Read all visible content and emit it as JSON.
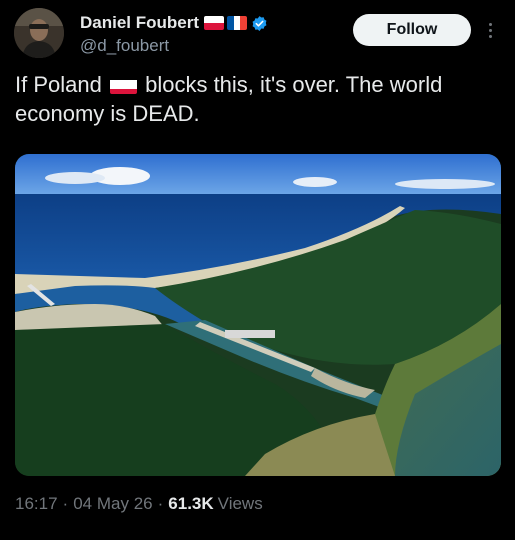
{
  "author": {
    "display_name": "Daniel Foubert",
    "handle": "@d_foubert",
    "flags": [
      "poland-flag-icon",
      "france-flag-icon"
    ],
    "verified_color": "#1d9bf0"
  },
  "actions": {
    "follow_label": "Follow"
  },
  "tweet": {
    "text_part1": "If Poland",
    "text_part2": "blocks this, it's over. The world economy is DEAD."
  },
  "media": {
    "description_icon": "aerial-canal-photo"
  },
  "meta": {
    "time": "16:17",
    "date": "04 May 26",
    "views_count": "61.3K",
    "views_label": "Views"
  },
  "colors": {
    "background": "#000000",
    "text_primary": "#e7e9ea",
    "text_secondary": "#71767b",
    "follow_bg": "#eff3f4"
  }
}
